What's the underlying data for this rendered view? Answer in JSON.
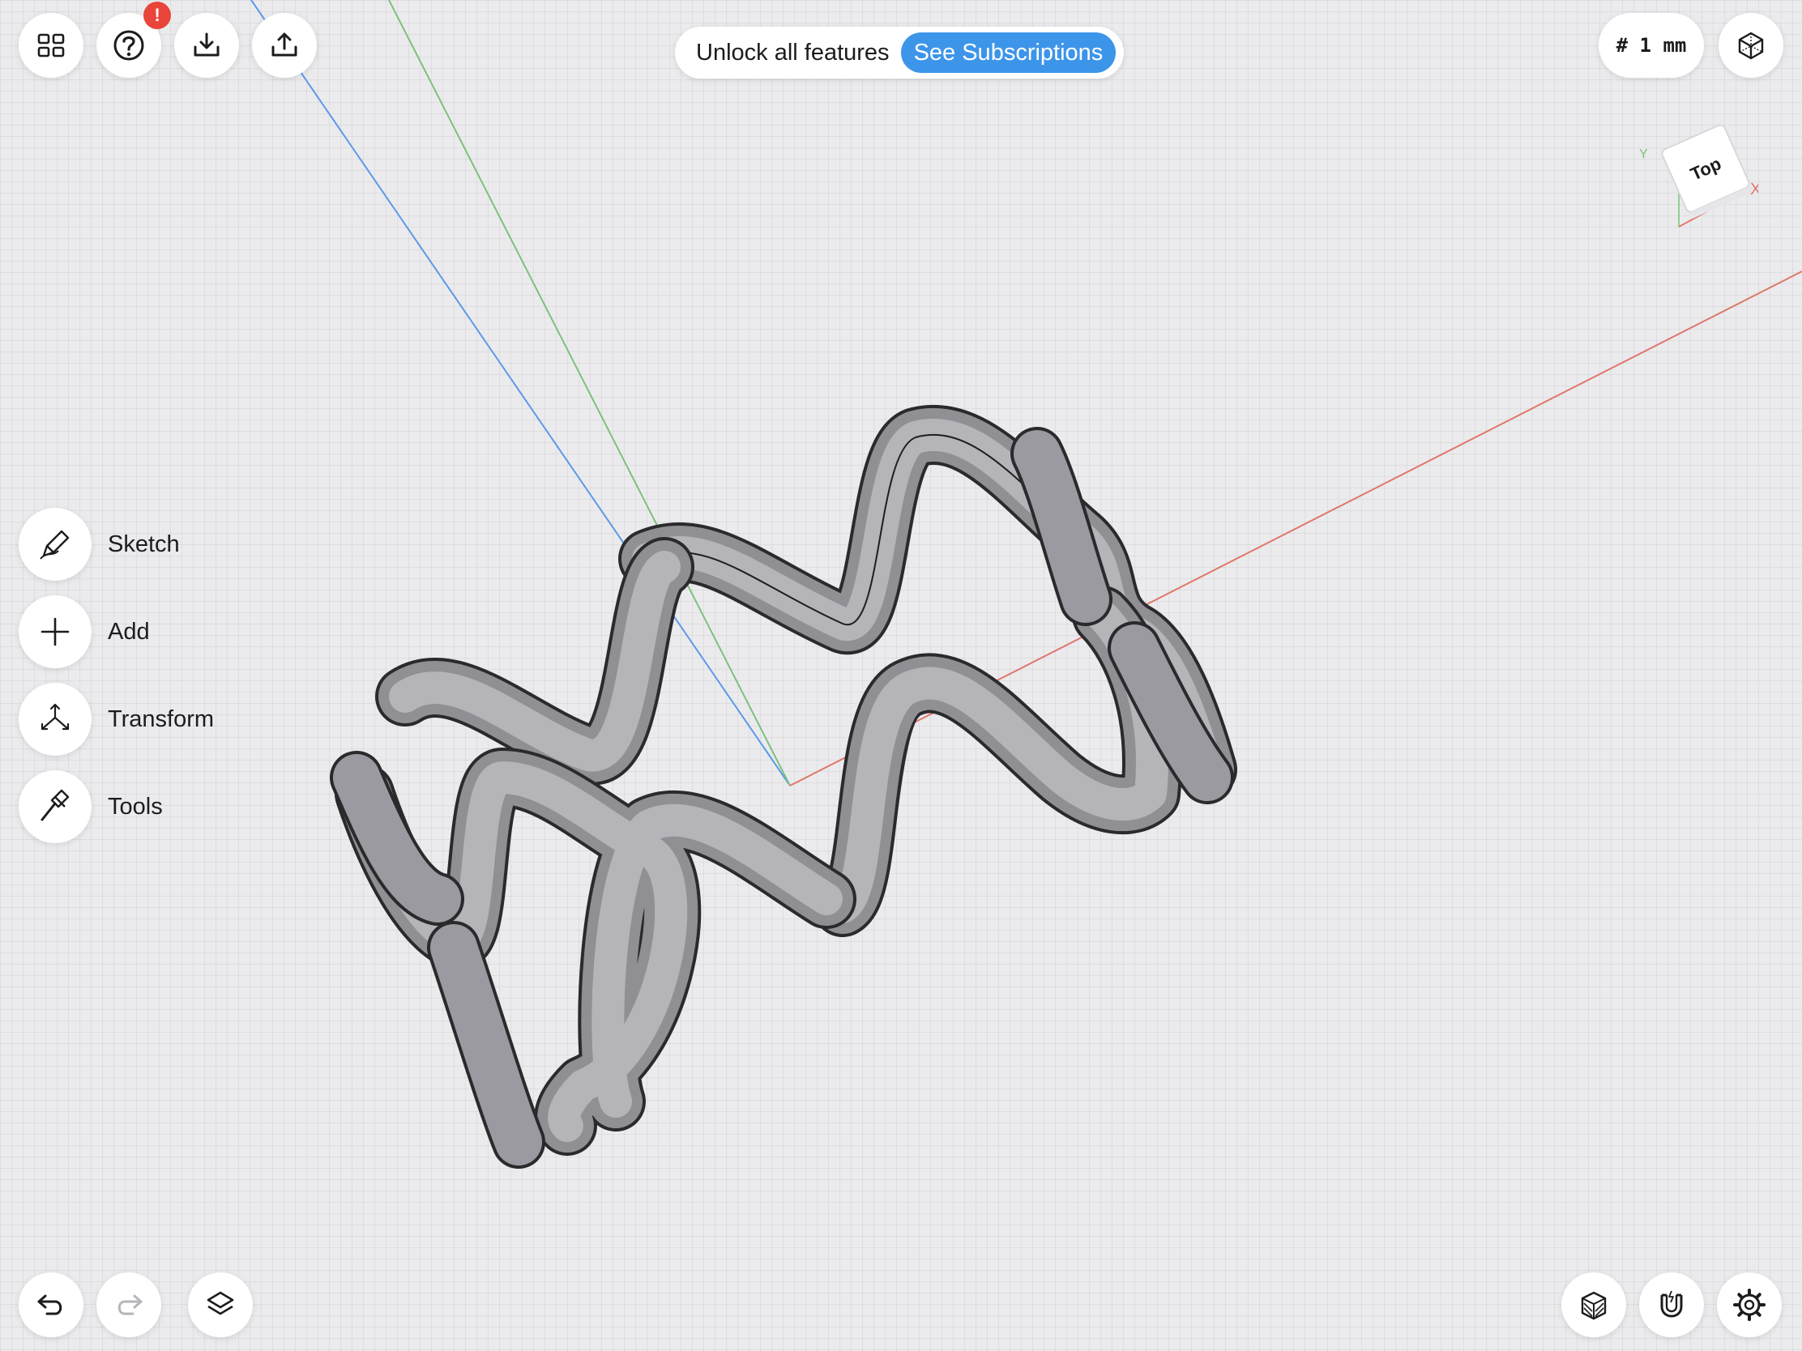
{
  "toolbar_top": {
    "menu_icon": "grid-menu-icon",
    "help_icon": "question-mark-icon",
    "help_badge": "!",
    "import_icon": "download-tray-icon",
    "export_icon": "share-upload-icon"
  },
  "banner": {
    "text": "Unlock all features",
    "button_label": "See Subscriptions"
  },
  "grid_indicator": {
    "label": "# 1 mm"
  },
  "view_mode_icon": "isometric-cube-icon",
  "viewcube": {
    "face_label": "Top",
    "axis_x_label": "X",
    "axis_y_label": "Y"
  },
  "sidebar": {
    "items": [
      {
        "label": "Sketch",
        "icon": "pencil-sketch-icon"
      },
      {
        "label": "Add",
        "icon": "plus-icon"
      },
      {
        "label": "Transform",
        "icon": "transform-arrows-icon"
      },
      {
        "label": "Tools",
        "icon": "hammer-icon"
      }
    ]
  },
  "toolbar_bottom": {
    "undo_icon": "undo-icon",
    "redo_icon": "redo-icon",
    "layers_icon": "layers-icon",
    "section_icon": "section-view-icon",
    "snap_icon": "magnet-snap-icon",
    "settings_icon": "gear-icon"
  },
  "colors": {
    "accent": "#3d95ea",
    "badge": "#e9453a",
    "axis_x": "#e0776a",
    "axis_y": "#7cc27a",
    "axis_z": "#5b9ae8",
    "model_fill": "#8e8e93"
  }
}
